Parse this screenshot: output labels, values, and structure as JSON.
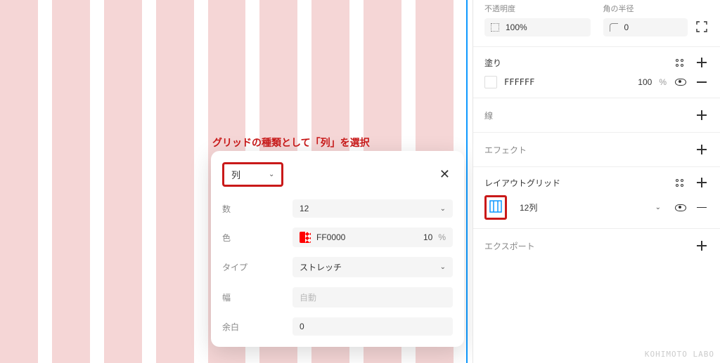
{
  "annotation": "グリッドの種類として「列」を選択",
  "popup": {
    "grid_type": "列",
    "count_label": "数",
    "count_value": "12",
    "color_label": "色",
    "color_hex": "FF0000",
    "color_opacity": "10",
    "type_label": "タイプ",
    "type_value": "ストレッチ",
    "width_label": "幅",
    "width_placeholder": "自動",
    "margin_label": "余白",
    "margin_value": "0",
    "pct": "%"
  },
  "sidebar": {
    "opacity_label": "不透明度",
    "opacity_value": "100%",
    "radius_label": "角の半径",
    "radius_value": "0",
    "fill_title": "塗り",
    "fill_hex": "FFFFFF",
    "fill_opacity": "100",
    "pct": "%",
    "stroke_title": "線",
    "effect_title": "エフェクト",
    "grid_title": "レイアウトグリッド",
    "grid_item": "12列",
    "export_title": "エクスポート"
  },
  "watermark": "KOHIMOTO LABO"
}
